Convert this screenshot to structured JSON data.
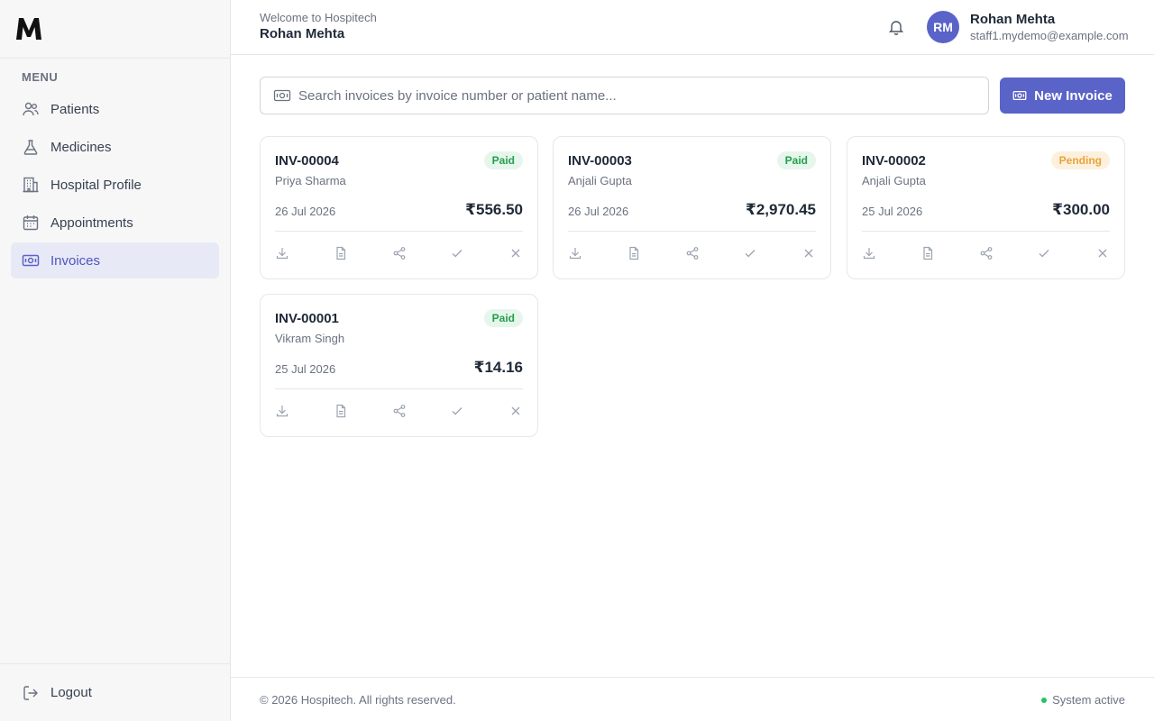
{
  "sidebar": {
    "logo_icon": "m-logo-icon",
    "menu_heading": "MENU",
    "items": [
      {
        "label": "Patients",
        "icon": "users-icon"
      },
      {
        "label": "Medicines",
        "icon": "flask-icon"
      },
      {
        "label": "Hospital Profile",
        "icon": "building-icon"
      },
      {
        "label": "Appointments",
        "icon": "calendar-icon"
      },
      {
        "label": "Invoices",
        "icon": "banknote-icon",
        "active": true
      }
    ],
    "logout_label": "Logout"
  },
  "header": {
    "welcome": "Welcome to Hospitech",
    "name": "Rohan Mehta",
    "user": {
      "initials": "RM",
      "name": "Rohan Mehta",
      "email": "staff1.mydemo@example.com"
    }
  },
  "main": {
    "search": {
      "placeholder": "Search invoices by invoice number or patient name...",
      "value": ""
    },
    "new_invoice_label": "New Invoice",
    "invoices": [
      {
        "number": "INV-00004",
        "patient": "Priya Sharma",
        "status": "Paid",
        "date": "26 Jul 2026",
        "amount": "₹556.50"
      },
      {
        "number": "INV-00003",
        "patient": "Anjali Gupta",
        "status": "Paid",
        "date": "26 Jul 2026",
        "amount": "₹2,970.45"
      },
      {
        "number": "INV-00002",
        "patient": "Anjali Gupta",
        "status": "Pending",
        "date": "25 Jul 2026",
        "amount": "₹300.00"
      },
      {
        "number": "INV-00001",
        "patient": "Vikram Singh",
        "status": "Paid",
        "date": "25 Jul 2026",
        "amount": "₹14.16"
      }
    ],
    "card_actions": [
      "download-icon",
      "file-icon",
      "share-icon",
      "check-icon",
      "close-icon"
    ]
  },
  "footer": {
    "copyright": "© 2026 Hospitech. All rights reserved.",
    "status": "System active"
  },
  "colors": {
    "accent": "#5a63c8",
    "paid": "#22a04b",
    "pending": "#e9a23b",
    "status_dot": "#22c55e"
  }
}
